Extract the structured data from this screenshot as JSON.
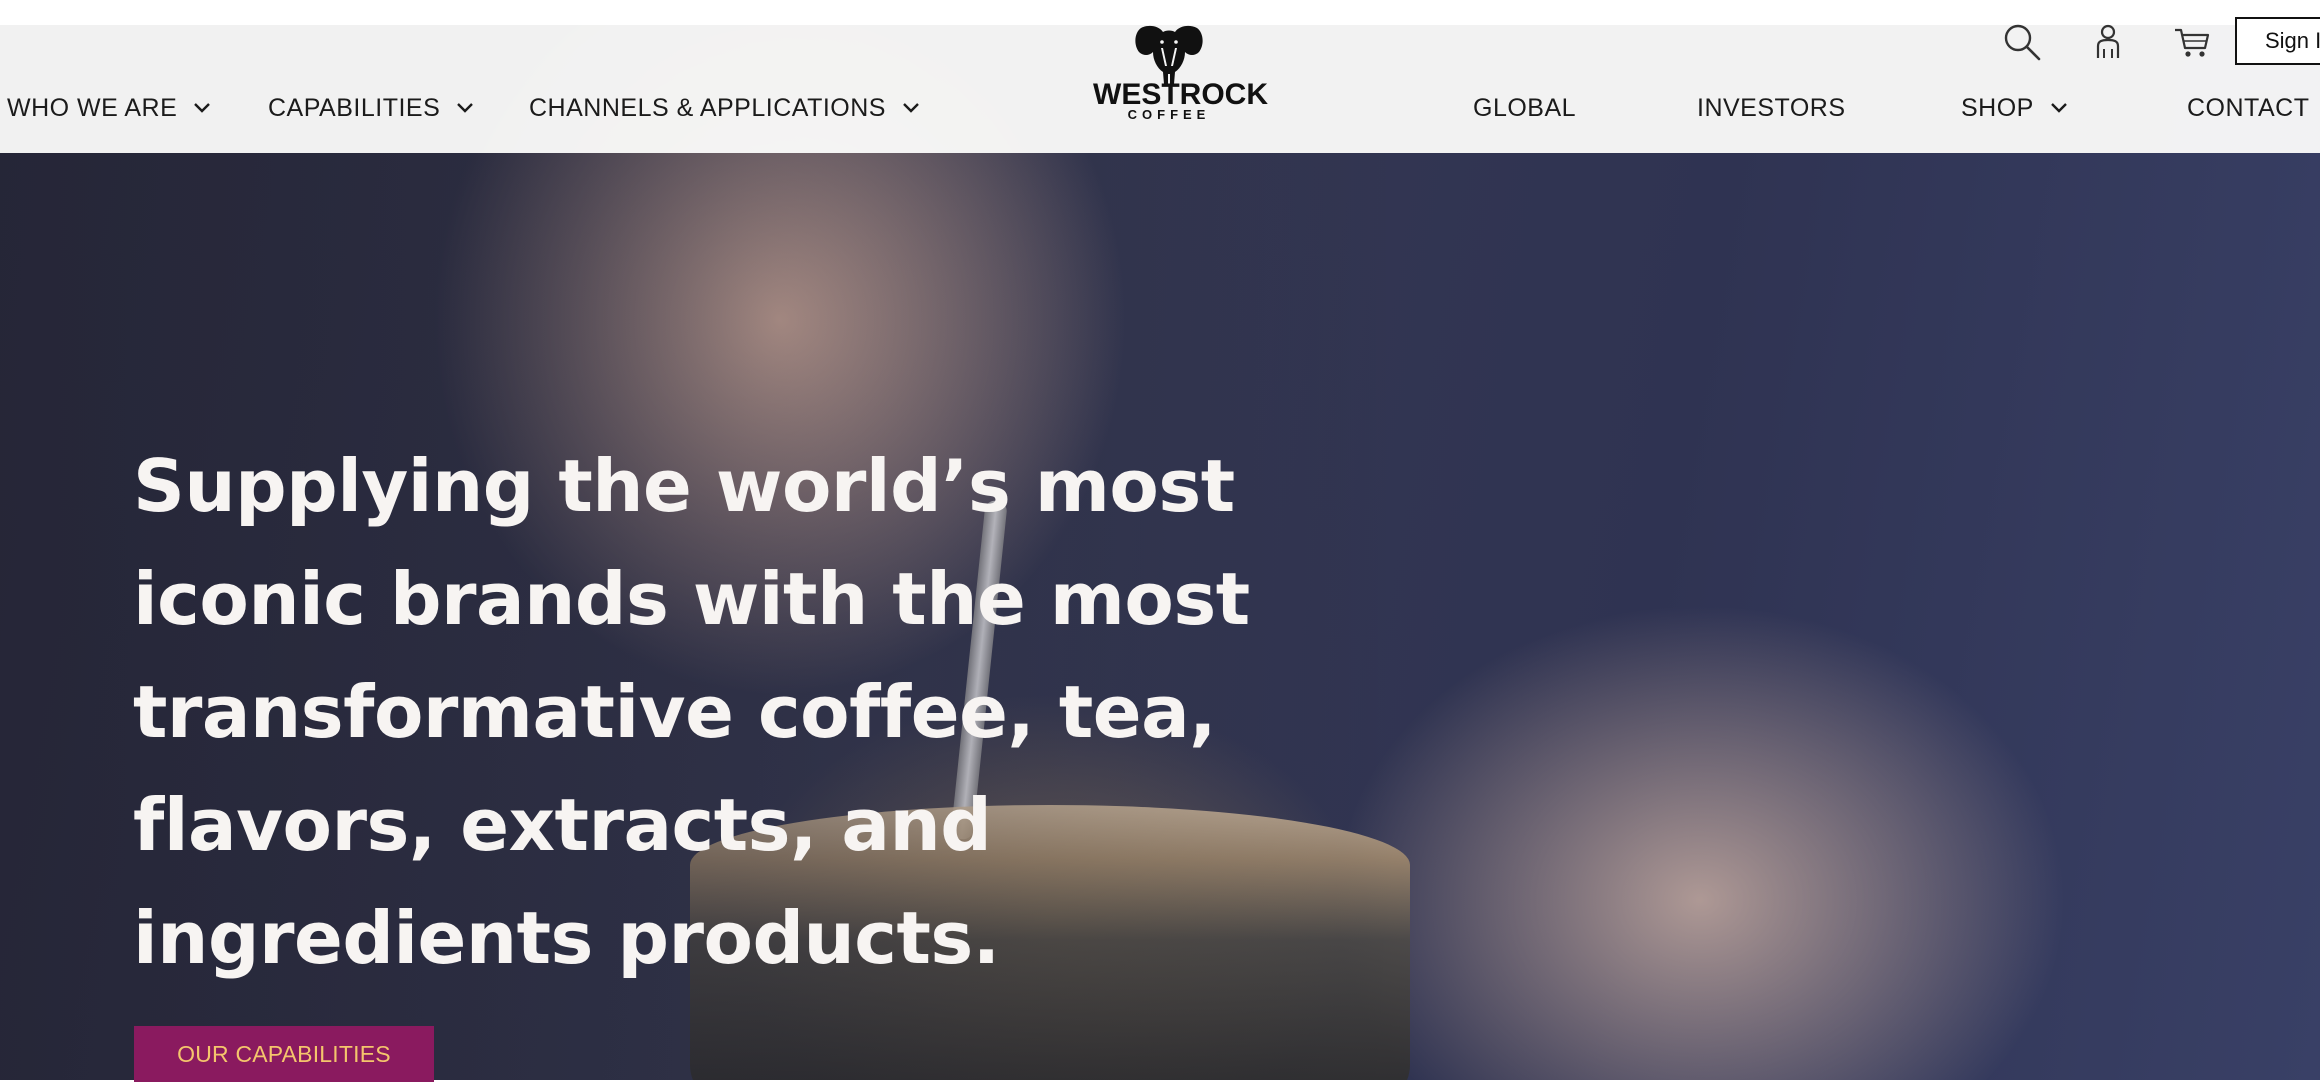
{
  "nav_left": [
    {
      "label": "WHO WE ARE",
      "has_dropdown": true
    },
    {
      "label": "CAPABILITIES",
      "has_dropdown": true
    },
    {
      "label": "CHANNELS & APPLICATIONS",
      "has_dropdown": true
    }
  ],
  "logo": {
    "word": "WESTROCK",
    "sub": "COFFEE",
    "icon": "elephant-icon"
  },
  "nav_right": [
    {
      "label": "GLOBAL",
      "has_dropdown": false
    },
    {
      "label": "INVESTORS",
      "has_dropdown": false
    },
    {
      "label": "SHOP",
      "has_dropdown": true
    },
    {
      "label": "CONTACT",
      "has_dropdown": false
    }
  ],
  "utility": {
    "icons": [
      "search-icon",
      "account-icon",
      "cart-icon"
    ],
    "signin_label": "Sign I"
  },
  "hero": {
    "headline": "Supplying the world’s most iconic brands with the most transformative coffee, tea, flavors, extracts, and ingredients products.",
    "cta_label": "OUR CAPABILITIES"
  },
  "colors": {
    "cta_bg": "#8a1a5f",
    "cta_text": "#f4c56c",
    "headline": "#f7f4f2"
  }
}
